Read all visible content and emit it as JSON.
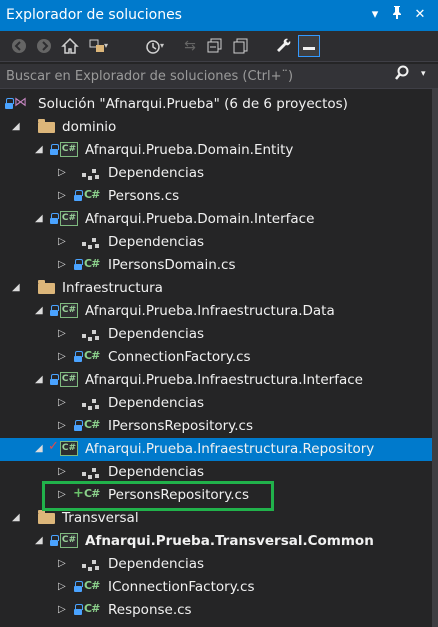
{
  "titlebar": {
    "title": "Explorador de soluciones",
    "dropdown_glyph": "▾",
    "pin_glyph": "📌",
    "close_glyph": "✕"
  },
  "toolbar": {
    "back_glyph": "◀",
    "forward_glyph": "▶",
    "home_glyph": "⌂",
    "switch_views_glyph": "⇄",
    "pending_changes_glyph": "⏱",
    "sync_glyph": "⇆",
    "collapse_all_glyph": "⧉",
    "show_all_files_glyph": "▤",
    "properties_glyph": "🔧",
    "preview_glyph": "▬",
    "dropdown_glyph": "▾"
  },
  "search": {
    "placeholder": "Buscar en Explorador de soluciones (Ctrl+¨)",
    "icon_glyph": "⚲",
    "dropdown_glyph": "▾"
  },
  "icons": {
    "cs": "C#",
    "expand_open": "◢",
    "expand_closed": "▷",
    "plus": "+",
    "check": "✓",
    "solution": "⋈"
  },
  "tree": {
    "solution_label": "Solución \"Afnarqui.Prueba\" (6 de 6 proyectos)",
    "folder_dominio": "dominio",
    "proj_domain_entity": "Afnarqui.Prueba.Domain.Entity",
    "dep_1": "Dependencias",
    "file_persons": "Persons.cs",
    "proj_domain_interface": "Afnarqui.Prueba.Domain.Interface",
    "dep_2": "Dependencias",
    "file_ipersons_domain": "IPersonsDomain.cs",
    "folder_infra": "Infraestructura",
    "proj_infra_data": "Afnarqui.Prueba.Infraestructura.Data",
    "dep_3": "Dependencias",
    "file_connection_factory": "ConnectionFactory.cs",
    "proj_infra_interface": "Afnarqui.Prueba.Infraestructura.Interface",
    "dep_4": "Dependencias",
    "file_ipersons_repo": "IPersonsRepository.cs",
    "proj_infra_repository": "Afnarqui.Prueba.Infraestructura.Repository",
    "dep_5": "Dependencias",
    "file_persons_repo": "PersonsRepository.cs",
    "folder_transversal": "Transversal",
    "proj_transversal_common": "Afnarqui.Prueba.Transversal.Common",
    "dep_6": "Dependencias",
    "file_iconnection_factory": "IConnectionFactory.cs",
    "file_response": "Response.cs"
  },
  "colors": {
    "accent": "#007acc",
    "background": "#252526",
    "highlight_box": "#21b24b",
    "lock_blue": "#4aa3ff",
    "cs_green": "#8bd08b",
    "folder": "#dcb67a"
  }
}
